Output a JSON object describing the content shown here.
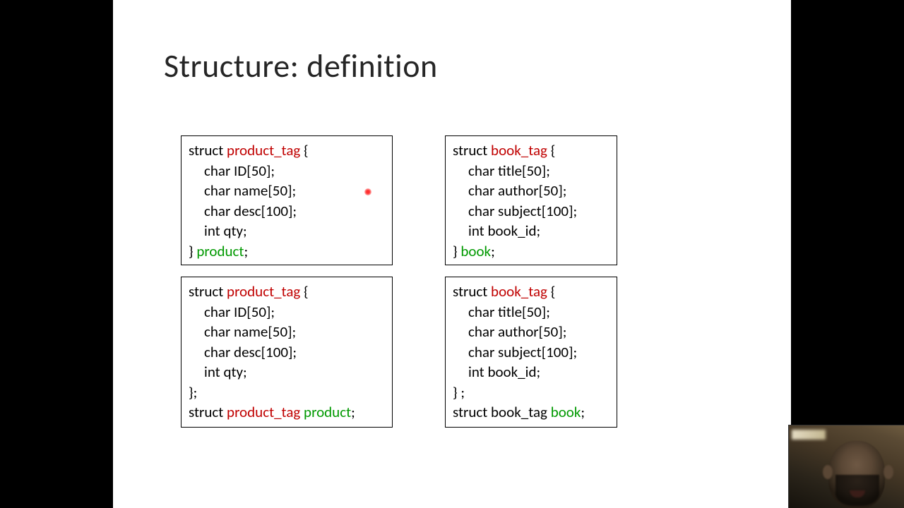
{
  "title": "Structure: definition",
  "colors": {
    "tag": "#c00000",
    "var": "#009900"
  },
  "box1": {
    "l1a": "struct ",
    "l1b": "product_tag",
    "l1c": " {",
    "l2": "char ID[50];",
    "l3": "char name[50];",
    "l4": "char desc[100];",
    "l5": "int qty;",
    "l6a": "} ",
    "l6b": "product",
    "l6c": ";"
  },
  "box2": {
    "l1a": "struct ",
    "l1b": "product_tag",
    "l1c": " {",
    "l2": "char ID[50];",
    "l3": "char name[50];",
    "l4": "char desc[100];",
    "l5": "int qty;",
    "l6": "};",
    "l7a": "struct ",
    "l7b": "product_tag",
    "l7c": " ",
    "l7d": "product",
    "l7e": ";"
  },
  "box3": {
    "l1a": "struct ",
    "l1b": "book_tag",
    "l1c": " {",
    "l2": "char title[50];",
    "l3": "char author[50];",
    "l4": "char subject[100];",
    "l5": "int book_id;",
    "l6a": "} ",
    "l6b": "book",
    "l6c": ";"
  },
  "box4": {
    "l1a": "struct ",
    "l1b": "book_tag",
    "l1c": " {",
    "l2": "char title[50];",
    "l3": "char author[50];",
    "l4": "char subject[100];",
    "l5": "int book_id;",
    "l6": "} ;",
    "l7a": "struct book_tag ",
    "l7b": "book",
    "l7c": ";"
  }
}
